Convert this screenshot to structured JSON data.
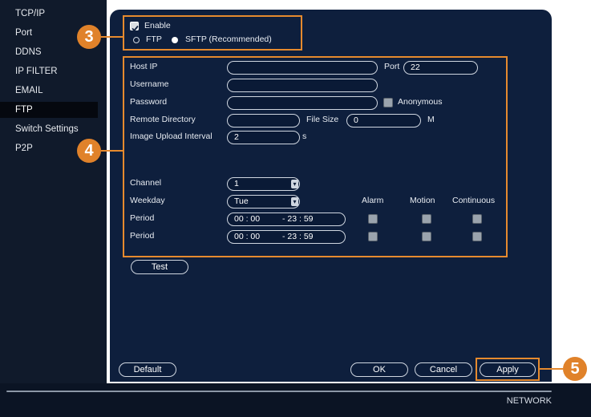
{
  "sidebar": {
    "items": [
      {
        "label": "TCP/IP"
      },
      {
        "label": "Port"
      },
      {
        "label": "DDNS"
      },
      {
        "label": "IP FILTER"
      },
      {
        "label": "EMAIL"
      },
      {
        "label": "FTP"
      },
      {
        "label": "Switch Settings"
      },
      {
        "label": "P2P"
      }
    ]
  },
  "enable": {
    "label": "Enable",
    "checked": true
  },
  "protocol": {
    "ftp_label": "FTP",
    "sftp_label": "SFTP (Recommended)",
    "selected": "SFTP (Recommended)"
  },
  "form": {
    "host_ip_label": "Host IP",
    "host_ip_value": "",
    "port_label": "Port",
    "port_value": "22",
    "username_label": "Username",
    "username_value": "",
    "password_label": "Password",
    "password_value": "",
    "anonymous_label": "Anonymous",
    "remote_dir_label": "Remote Directory",
    "remote_dir_value": "",
    "file_size_label": "File Size",
    "file_size_value": "0",
    "file_size_unit": "M",
    "upload_interval_label": "Image Upload Interval",
    "upload_interval_value": "2",
    "upload_interval_unit": "s",
    "channel_label": "Channel",
    "channel_value": "1",
    "weekday_label": "Weekday",
    "weekday_value": "Tue",
    "col_alarm": "Alarm",
    "col_motion": "Motion",
    "col_continuous": "Continuous",
    "periods": [
      {
        "label": "Period",
        "start": "00 : 00",
        "end": "- 23 : 59"
      },
      {
        "label": "Period",
        "start": "00 : 00",
        "end": "- 23 : 59"
      }
    ]
  },
  "buttons": {
    "test": "Test",
    "default": "Default",
    "ok": "OK",
    "cancel": "Cancel",
    "apply": "Apply"
  },
  "callouts": {
    "c3": "3",
    "c4": "4",
    "c5": "5"
  },
  "footer": {
    "section": "NETWORK"
  },
  "colors": {
    "accent": "#e68a2e",
    "panel": "#0e1f3d",
    "sidebar": "#101a2b"
  }
}
